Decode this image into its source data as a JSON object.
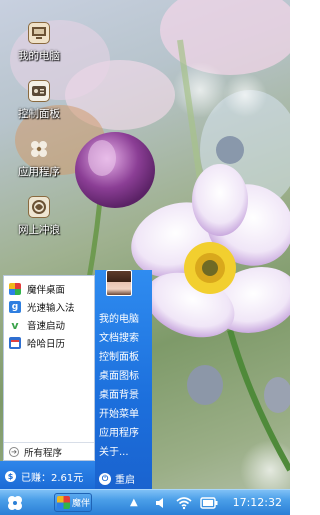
{
  "desktop": {
    "icons": [
      {
        "label": "我的电脑",
        "icon": "computer-icon"
      },
      {
        "label": "控制面板",
        "icon": "control-panel-icon"
      },
      {
        "label": "应用程序",
        "icon": "applications-icon"
      },
      {
        "label": "网上冲浪",
        "icon": "browser-icon"
      }
    ]
  },
  "start_menu": {
    "apps": [
      {
        "label": "魔伴桌面",
        "icon": "pinwheel-icon",
        "color": "#4aa1e8"
      },
      {
        "label": "光速输入法",
        "icon": "input-method-icon",
        "color": "#2f7fe0"
      },
      {
        "label": "音速启动",
        "icon": "launcher-icon",
        "color": "#3aa34b"
      },
      {
        "label": "哈哈日历",
        "icon": "calendar-icon",
        "color": "#2f6fd0"
      }
    ],
    "all_programs": "所有程序",
    "quick_links": [
      "我的电脑",
      "文档搜索",
      "控制面板",
      "桌面图标",
      "桌面背景",
      "开始菜单",
      "应用程序",
      "关于..."
    ],
    "earned": "已赚：2.61元",
    "reboot": "重启"
  },
  "taskbar": {
    "start_icon": "pinwheel-icon",
    "app_label": "魔伴",
    "tray_up": "▲",
    "time": "17:12:32"
  },
  "colors": {
    "menu_blue": "#1c6fdc",
    "taskbar_blue": "#4a9ee8"
  }
}
